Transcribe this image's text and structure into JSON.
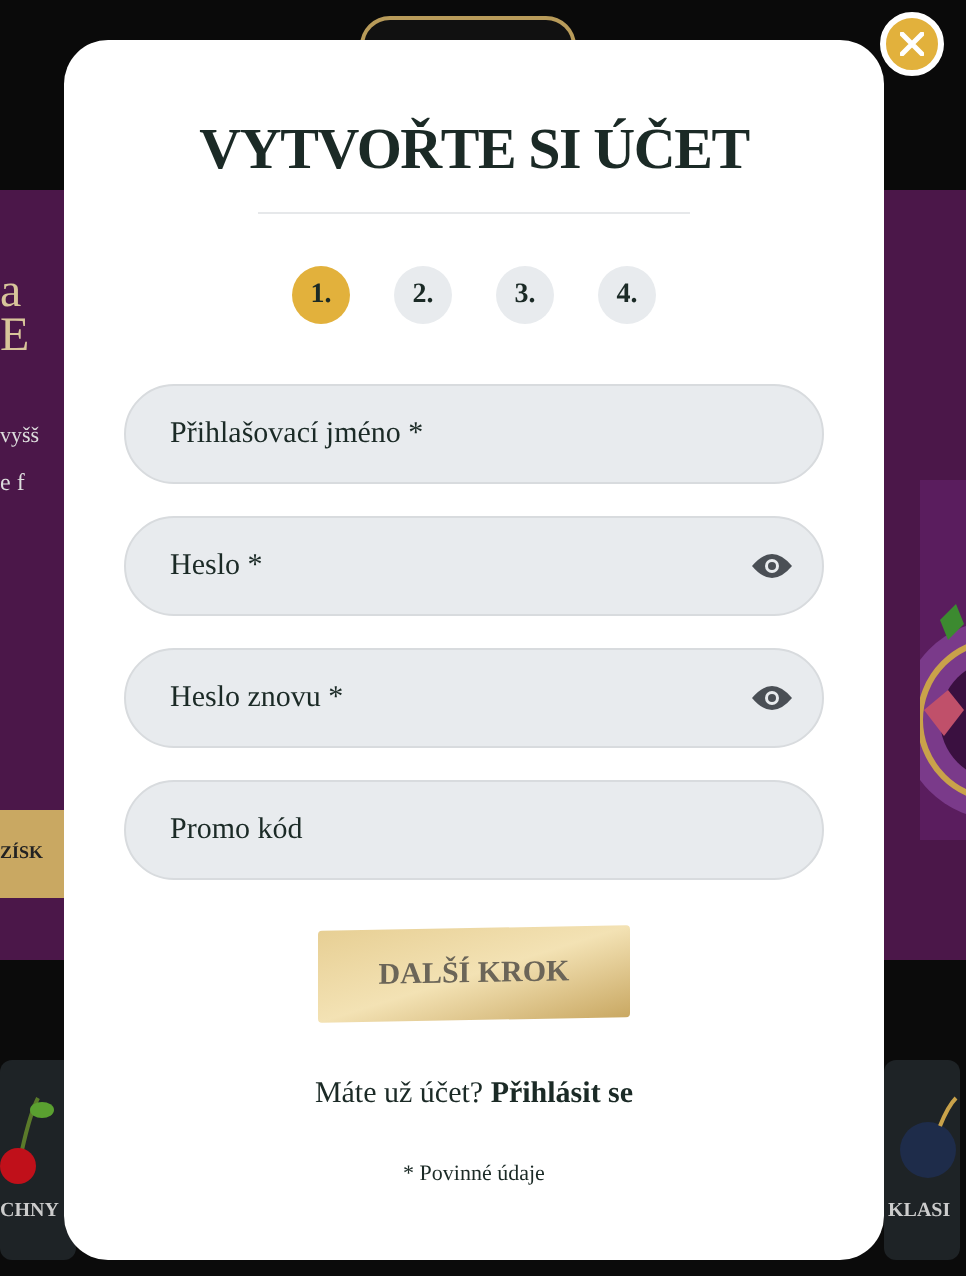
{
  "background": {
    "banner_fragments": [
      "a",
      "E",
      "vyšš",
      "e f"
    ],
    "banner_button": "ZÍSK",
    "categories": [
      {
        "label": "CHNY",
        "kind": "cherry"
      },
      {
        "label": "KLASI",
        "kind": "bomb"
      }
    ]
  },
  "modal": {
    "title": "VYTVOŘTE SI ÚČET",
    "steps": [
      {
        "label": "1.",
        "selected": true
      },
      {
        "label": "2.",
        "selected": false
      },
      {
        "label": "3.",
        "selected": false
      },
      {
        "label": "4.",
        "selected": false
      }
    ],
    "fields": [
      {
        "placeholder": "Přihlašovací jméno *",
        "kind": "text"
      },
      {
        "placeholder": "Heslo *",
        "kind": "password"
      },
      {
        "placeholder": "Heslo znovu *",
        "kind": "password"
      },
      {
        "placeholder": "Promo kód",
        "kind": "text"
      }
    ],
    "next_button": "DALŠÍ KROK",
    "login_prompt": "Máte už účet?",
    "login_link": "Přihlásit se",
    "required_note": "* Povinné údaje"
  }
}
